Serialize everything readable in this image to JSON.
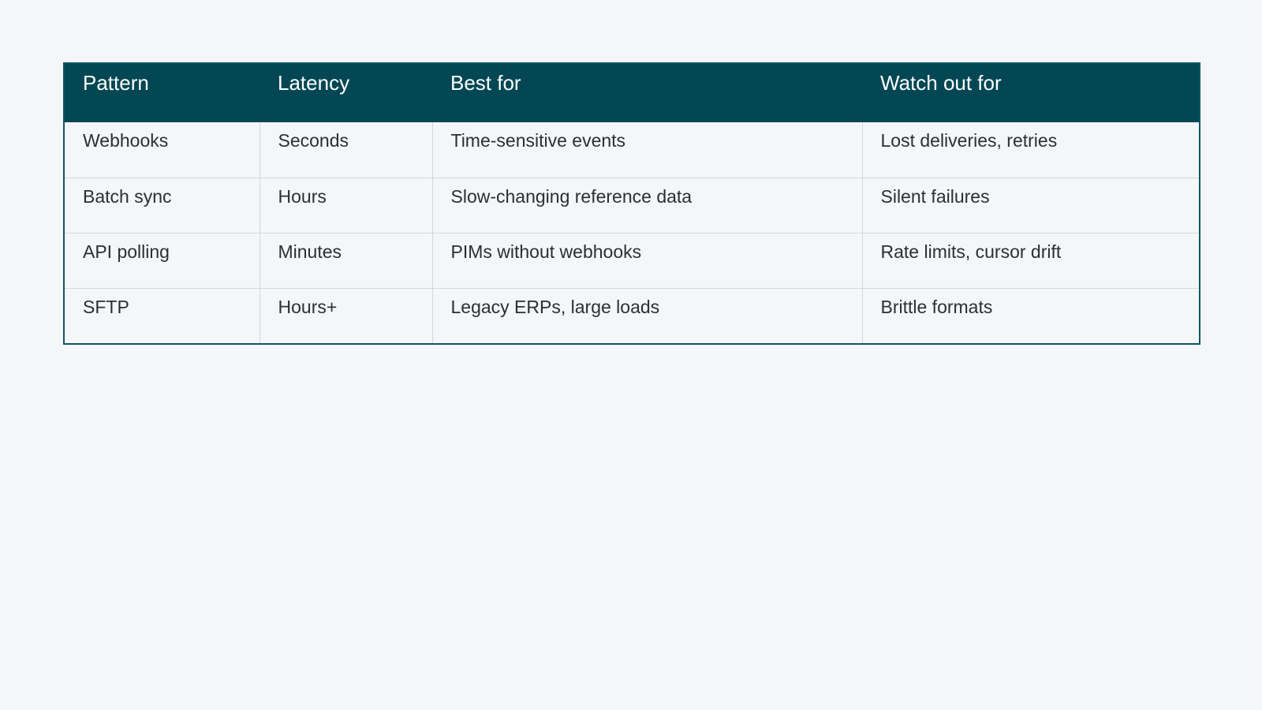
{
  "table": {
    "headers": [
      "Pattern",
      "Latency",
      "Best for",
      "Watch out for"
    ],
    "rows": [
      [
        "Webhooks",
        "Seconds",
        "Time-sensitive events",
        "Lost deliveries, retries"
      ],
      [
        "Batch sync",
        "Hours",
        "Slow-changing reference data",
        "Silent failures"
      ],
      [
        "API polling",
        "Minutes",
        "PIMs without webhooks",
        "Rate limits, cursor drift"
      ],
      [
        "SFTP",
        "Hours+",
        "Legacy ERPs, large loads",
        "Brittle formats"
      ]
    ]
  },
  "colors": {
    "header_background": "#024753",
    "border": "#0e5765",
    "page_background": "#f4f6f8"
  }
}
